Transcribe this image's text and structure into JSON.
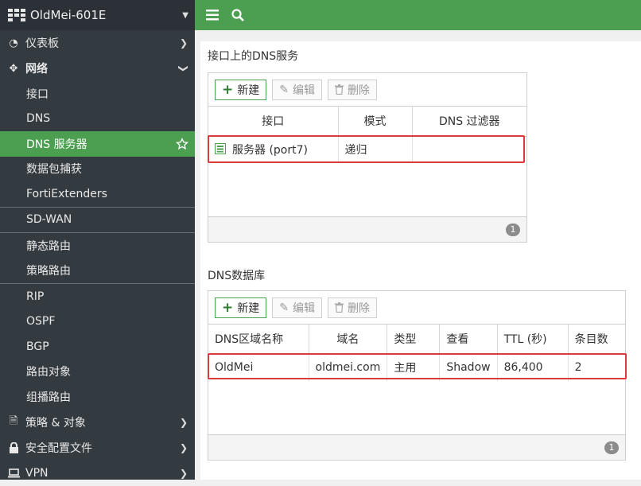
{
  "app": {
    "device_name": "OldMei-601E"
  },
  "sidebar": {
    "items": [
      {
        "label": "仪表板",
        "level": "top",
        "icon": "dashboard-icon",
        "chevron": "right"
      },
      {
        "label": "网络",
        "level": "top",
        "icon": "move-arrows-icon",
        "chevron": "down",
        "bold": true
      },
      {
        "label": "接口",
        "level": "sub"
      },
      {
        "label": "DNS",
        "level": "sub"
      },
      {
        "label": "DNS 服务器",
        "level": "sub",
        "active": true
      },
      {
        "label": "数据包捕获",
        "level": "sub"
      },
      {
        "label": "FortiExtenders",
        "level": "sub"
      },
      {
        "label": "SD-WAN",
        "level": "sub"
      },
      {
        "label": "静态路由",
        "level": "sub"
      },
      {
        "label": "策略路由",
        "level": "sub"
      },
      {
        "label": "RIP",
        "level": "sub"
      },
      {
        "label": "OSPF",
        "level": "sub"
      },
      {
        "label": "BGP",
        "level": "sub"
      },
      {
        "label": "路由对象",
        "level": "sub"
      },
      {
        "label": "组播路由",
        "level": "sub"
      },
      {
        "label": "策略 & 对象",
        "level": "top",
        "icon": "document-icon",
        "chevron": "right"
      },
      {
        "label": "安全配置文件",
        "level": "top",
        "icon": "lock-icon",
        "chevron": "right"
      },
      {
        "label": "VPN",
        "level": "top",
        "icon": "laptop-icon",
        "chevron": "right"
      }
    ]
  },
  "section1": {
    "title": "接口上的DNS服务",
    "toolbar": {
      "new": "新建",
      "edit": "编辑",
      "delete": "删除"
    },
    "columns": [
      "接口",
      "模式",
      "DNS 过滤器"
    ],
    "row": {
      "interface": "服务器 (port7)",
      "mode": "递归",
      "filter": ""
    },
    "count": "1"
  },
  "section2": {
    "title": "DNS数据库",
    "toolbar": {
      "new": "新建",
      "edit": "编辑",
      "delete": "删除"
    },
    "columns": [
      "DNS区域名称",
      "域名",
      "类型",
      "查看",
      "TTL (秒)",
      "条目数"
    ],
    "row": {
      "zone": "OldMei",
      "domain": "oldmei.com",
      "type": "主用",
      "view": "Shadow",
      "ttl": "86,400",
      "entries": "2"
    },
    "count": "1"
  },
  "colors": {
    "accent": "#4c9f50",
    "sidebar_bg": "#333b40",
    "highlight": "#d93a3a"
  }
}
